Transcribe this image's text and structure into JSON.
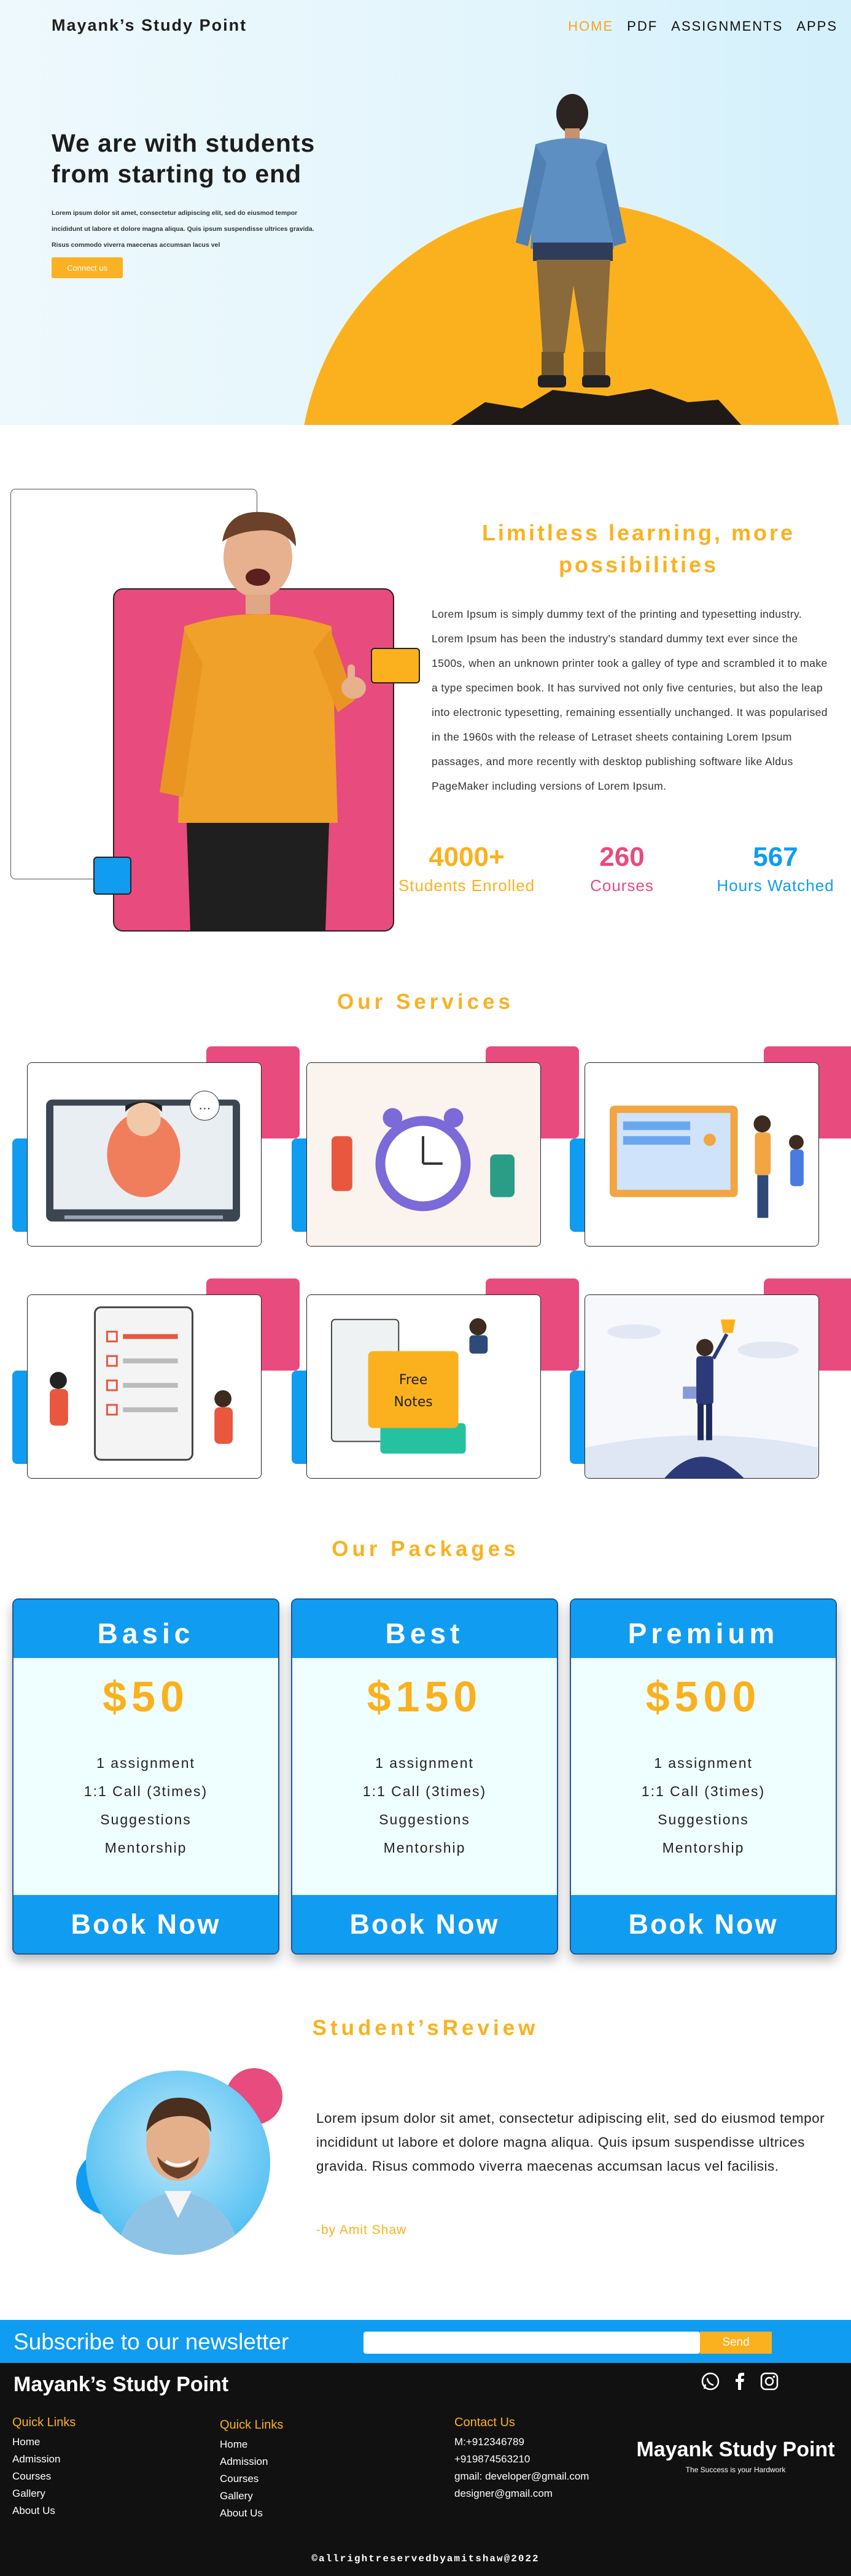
{
  "header": {
    "brand": "Mayank’s Study Point",
    "nav": [
      "HOME",
      "PDF",
      "ASSIGNMENTS",
      "APPS"
    ]
  },
  "hero": {
    "title": "We are with students from starting to end",
    "body": "Lorem ipsum dolor sit amet, consectetur adipiscing elit, sed do eiusmod tempor incididunt ut labore et dolore magna aliqua. Quis ipsum suspendisse ultrices gravida. Risus commodo viverra maecenas accumsan lacus vel",
    "cta": "Connect us"
  },
  "about": {
    "title": "Limitless learning, more possibilities",
    "body": "Lorem Ipsum is simply dummy text of the printing and typesetting industry. Lorem Ipsum has been the industry's standard dummy text ever since the 1500s, when an unknown printer took a galley of type and scrambled it to make a type specimen book. It has survived not only five centuries, but also the leap into electronic typesetting, remaining essentially unchanged. It was popularised in the 1960s with the release of Letraset sheets containing Lorem Ipsum passages, and more recently with desktop publishing software like Aldus PageMaker including versions of Lorem Ipsum.",
    "stats": [
      {
        "value": "4000+",
        "label": "Students Enrolled",
        "color": "#fbb11e"
      },
      {
        "value": "260",
        "label": "Courses",
        "color": "#e84b7e"
      },
      {
        "value": "567",
        "label": "Hours Watched",
        "color": "#109cf1"
      }
    ]
  },
  "services": {
    "title": "Our Services",
    "cards": [
      {
        "illustration": "video-lecture-illustration"
      },
      {
        "illustration": "time-management-illustration"
      },
      {
        "illustration": "online-payment-illustration"
      },
      {
        "illustration": "checklist-assignment-illustration"
      },
      {
        "illustration": "free-notes-illustration",
        "label_line1": "Free",
        "label_line2": "Notes"
      },
      {
        "illustration": "achievement-trophy-illustration"
      }
    ]
  },
  "packages": {
    "title": "Our Packages",
    "items": [
      {
        "name": "Basic",
        "price": "$50",
        "features": [
          "1 assignment",
          "1:1 Call (3times)",
          "Suggestions",
          "Mentorship"
        ],
        "button": "Book Now"
      },
      {
        "name": "Best",
        "price": "$150",
        "features": [
          "1 assignment",
          "1:1 Call (3times)",
          "Suggestions",
          "Mentorship"
        ],
        "button": "Book Now"
      },
      {
        "name": "Premium",
        "price": "$500",
        "features": [
          "1 assignment",
          "1:1 Call (3times)",
          "Suggestions",
          "Mentorship"
        ],
        "button": "Book Now"
      }
    ]
  },
  "review": {
    "title": "Student’sReview",
    "text": "Lorem ipsum dolor sit amet, consectetur adipiscing elit, sed do eiusmod tempor incididunt ut labore et dolore magna aliqua. Quis ipsum suspendisse ultrices gravida. Risus commodo viverra maecenas accumsan lacus vel facilisis.",
    "author": "-by Amit Shaw"
  },
  "newsletter": {
    "title": "Subscribe to our newsletter",
    "input_value": "",
    "button": "Send"
  },
  "footer": {
    "brand": "Mayank’s Study Point",
    "social": [
      "whatsapp-icon",
      "facebook-icon",
      "instagram-icon"
    ],
    "quick_links_1": {
      "title": "Quick Links",
      "items": [
        "Home",
        "Admission",
        "Courses",
        "Gallery",
        "About Us"
      ]
    },
    "quick_links_2": {
      "title": "Quick Links",
      "items": [
        "Home",
        "Admission",
        "Courses",
        "Gallery",
        "About Us"
      ]
    },
    "contact": {
      "title": "Contact Us",
      "items": [
        "M:+912346789",
        "+919874563210",
        "gmail: developer@gmail.com",
        "designer@gmail.com"
      ]
    },
    "right_title": "Mayank Study Point",
    "right_subtitle": "The Success is your Hardwork",
    "copyright": "©allrightreservedbyamitshaw@2022"
  },
  "colors": {
    "accent": "#fbb11e",
    "pink": "#e84b7e",
    "blue": "#109cf1",
    "footer": "#111111"
  }
}
